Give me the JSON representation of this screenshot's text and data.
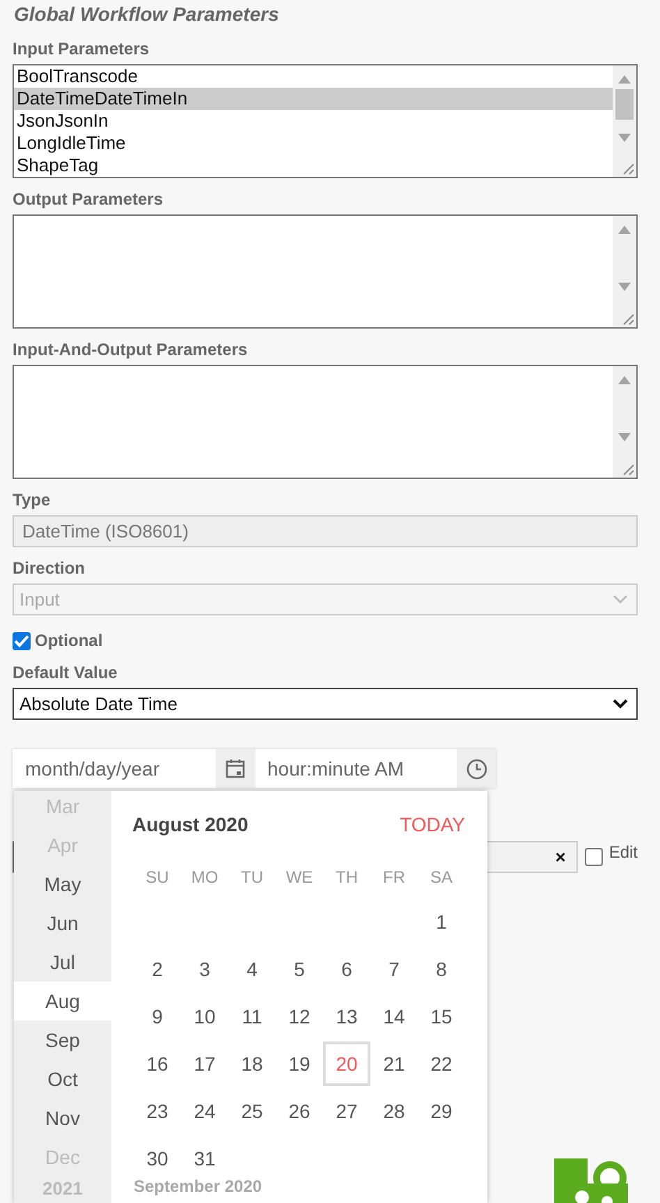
{
  "title": "Global Workflow Parameters",
  "input_parameters": {
    "label": "Input Parameters",
    "items": [
      {
        "text": "BoolTranscode",
        "selected": false
      },
      {
        "text": "DateTimeDateTimeIn",
        "selected": true
      },
      {
        "text": "JsonJsonIn",
        "selected": false
      },
      {
        "text": "LongIdleTime",
        "selected": false
      },
      {
        "text": "ShapeTag",
        "selected": false
      }
    ]
  },
  "output_parameters": {
    "label": "Output Parameters"
  },
  "input_output_parameters": {
    "label": "Input-And-Output Parameters"
  },
  "type": {
    "label": "Type",
    "value": "DateTime (ISO8601)"
  },
  "direction": {
    "label": "Direction",
    "value": "Input",
    "disabled": true
  },
  "optional": {
    "label": "Optional",
    "checked": true
  },
  "default_value": {
    "label": "Default Value",
    "value": "Absolute Date Time"
  },
  "date_input": {
    "placeholder": "month/day/year"
  },
  "time_input": {
    "placeholder": "hour:minute AM"
  },
  "value_field": {
    "clear": "×",
    "edit": {
      "label": "Edit",
      "checked": false
    }
  },
  "datepicker": {
    "months": [
      {
        "label": "Mar",
        "selected": false,
        "dim": true
      },
      {
        "label": "Apr",
        "selected": false,
        "dim": true
      },
      {
        "label": "May",
        "selected": false,
        "dim": false
      },
      {
        "label": "Jun",
        "selected": false,
        "dim": false
      },
      {
        "label": "Jul",
        "selected": false,
        "dim": false
      },
      {
        "label": "Aug",
        "selected": true,
        "dim": false
      },
      {
        "label": "Sep",
        "selected": false,
        "dim": false
      },
      {
        "label": "Oct",
        "selected": false,
        "dim": false
      },
      {
        "label": "Nov",
        "selected": false,
        "dim": false
      },
      {
        "label": "Dec",
        "selected": false,
        "dim": true
      }
    ],
    "year": "2021",
    "month_title": "August 2020",
    "today": "TODAY",
    "weekdays": [
      "SU",
      "MO",
      "TU",
      "WE",
      "TH",
      "FR",
      "SA"
    ],
    "weeks": [
      {
        "kind": "lead",
        "days": [
          {
            "day": "1",
            "today": false
          }
        ]
      },
      {
        "kind": "full",
        "days": [
          {
            "day": "2",
            "today": false
          },
          {
            "day": "3",
            "today": false
          },
          {
            "day": "4",
            "today": false
          },
          {
            "day": "5",
            "today": false
          },
          {
            "day": "6",
            "today": false
          },
          {
            "day": "7",
            "today": false
          },
          {
            "day": "8",
            "today": false
          }
        ]
      },
      {
        "kind": "full",
        "days": [
          {
            "day": "9",
            "today": false
          },
          {
            "day": "10",
            "today": false
          },
          {
            "day": "11",
            "today": false
          },
          {
            "day": "12",
            "today": false
          },
          {
            "day": "13",
            "today": false
          },
          {
            "day": "14",
            "today": false
          },
          {
            "day": "15",
            "today": false
          }
        ]
      },
      {
        "kind": "full",
        "days": [
          {
            "day": "16",
            "today": false
          },
          {
            "day": "17",
            "today": false
          },
          {
            "day": "18",
            "today": false
          },
          {
            "day": "19",
            "today": false
          },
          {
            "day": "20",
            "today": true
          },
          {
            "day": "21",
            "today": false
          },
          {
            "day": "22",
            "today": false
          }
        ]
      },
      {
        "kind": "full",
        "days": [
          {
            "day": "23",
            "today": false
          },
          {
            "day": "24",
            "today": false
          },
          {
            "day": "25",
            "today": false
          },
          {
            "day": "26",
            "today": false
          },
          {
            "day": "27",
            "today": false
          },
          {
            "day": "28",
            "today": false
          },
          {
            "day": "29",
            "today": false
          }
        ]
      },
      {
        "kind": "trail",
        "days": [
          {
            "day": "30",
            "today": false
          },
          {
            "day": "31",
            "today": false
          }
        ]
      }
    ],
    "next_title": "September 2020"
  }
}
